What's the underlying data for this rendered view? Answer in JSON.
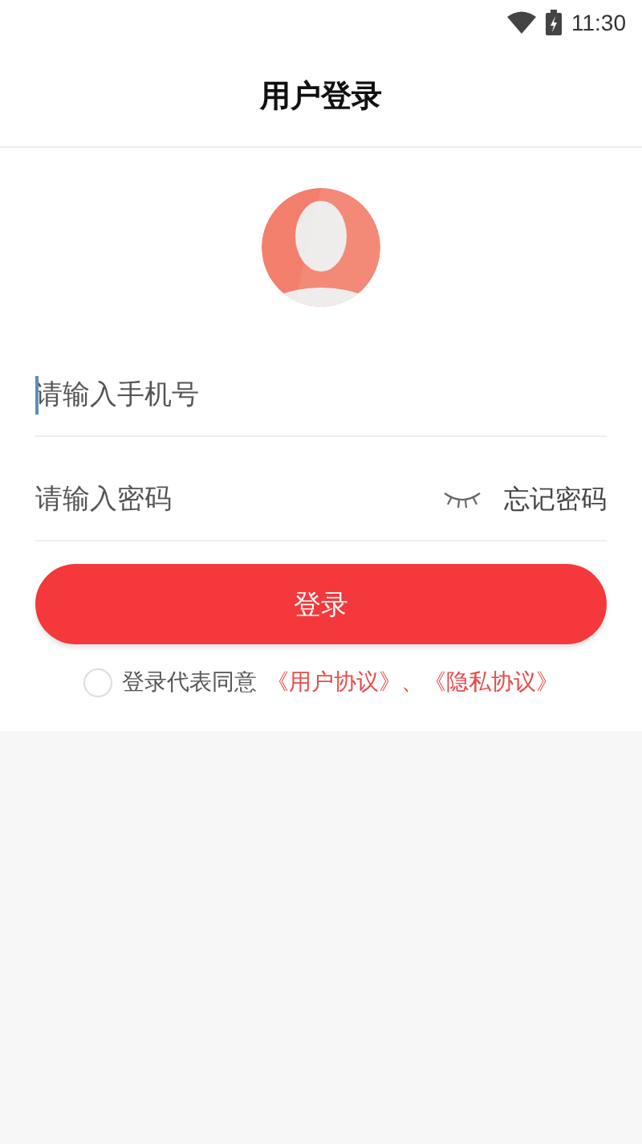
{
  "status_bar": {
    "time": "11:30"
  },
  "header": {
    "title": "用户登录"
  },
  "phone_field": {
    "placeholder": "请输入手机号",
    "focused": true
  },
  "password_field": {
    "placeholder": "请输入密码",
    "password_visible": false,
    "forgot_link": "忘记密码"
  },
  "login_button": {
    "label": "登录"
  },
  "agreement": {
    "checked": false,
    "text": "登录代表同意",
    "links": [
      "《用户协议》",
      "《隐私协议》"
    ],
    "separator": "、"
  }
}
